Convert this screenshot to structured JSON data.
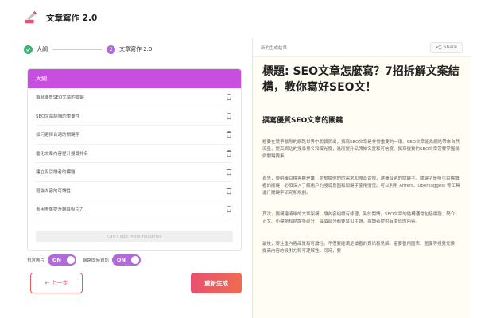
{
  "header": {
    "title": "文章寫作 2.0"
  },
  "stepper": {
    "step1": {
      "label": "大綱"
    },
    "step2": {
      "label": "文章寫作 2.0",
      "number": "2"
    }
  },
  "outline": {
    "header": "大綱",
    "items": [
      "撰寫優質SEO文章的關鍵",
      "SEO文章結構的重要性",
      "如何選擇合適的關鍵字",
      "優化文章內容提升搜尋排名",
      "建立吸引讀者的標題",
      "增強內容的可讀性",
      "善用圖像提升網頁吸引力"
    ],
    "cant_add": "Can't add more headings"
  },
  "toggles": {
    "images": {
      "label": "包含圖片",
      "state": "ON"
    },
    "web": {
      "label": "網路即時資訊",
      "state": "ON"
    }
  },
  "buttons": {
    "prev": "← 上一步",
    "regen": "重新生成"
  },
  "result": {
    "label": "新的生成結果",
    "share": "Share",
    "title": "標題: SEO文章怎麼寫？7招拆解文案結構，教你寫好SEO文！",
    "h2": "撰寫優質SEO文章的關鍵",
    "paragraphs": [
      "想要在競爭激烈的網路世界中脫穎而出，撰寫SEO文章是非常重要的一環。SEO文章能為網站帶來自然流量，提高網站的搜尋排名和曝光度，進而提升品牌知名度和可信度。撰寫優質的SEO文章需要掌握幾個關鍵要素:",
      "首先，要明確目標客群是誰，並根據他們的需求和搜尋習慣，選擇合適的關鍵字。關鍵字是吸引目標讀者的關鍵，必須深入了解用戶的搜尋意圖和關鍵字使用情況。可以利用 Ahrefs、Ubersuggest 等工具進行關鍵字研究和規劃。",
      "其次，要構建清晰的文章架構，讓內容組織有條理，易於閱讀。SEO文章的結構通常包括標題、簡介、正文、小標題和結論等部分，每個部分都要緊扣主題，為讀者提供有價值的內容。",
      "最後，要注重內容品質和可讀性。不僅要能滿足讀者的資訊和見解，還要善用圖表、圖像等視覺元素，提高內容的吸引力和可理解性。同時，要"
    ]
  },
  "colors": {
    "accent": "#c84ee0",
    "step_done": "#3cb371",
    "danger": "#e55a5a",
    "result_bg": "#fffdf4"
  },
  "icons": {
    "logo": "pen-brush-icon",
    "trash": "trash-icon",
    "share": "share-icon",
    "check": "check-icon"
  }
}
